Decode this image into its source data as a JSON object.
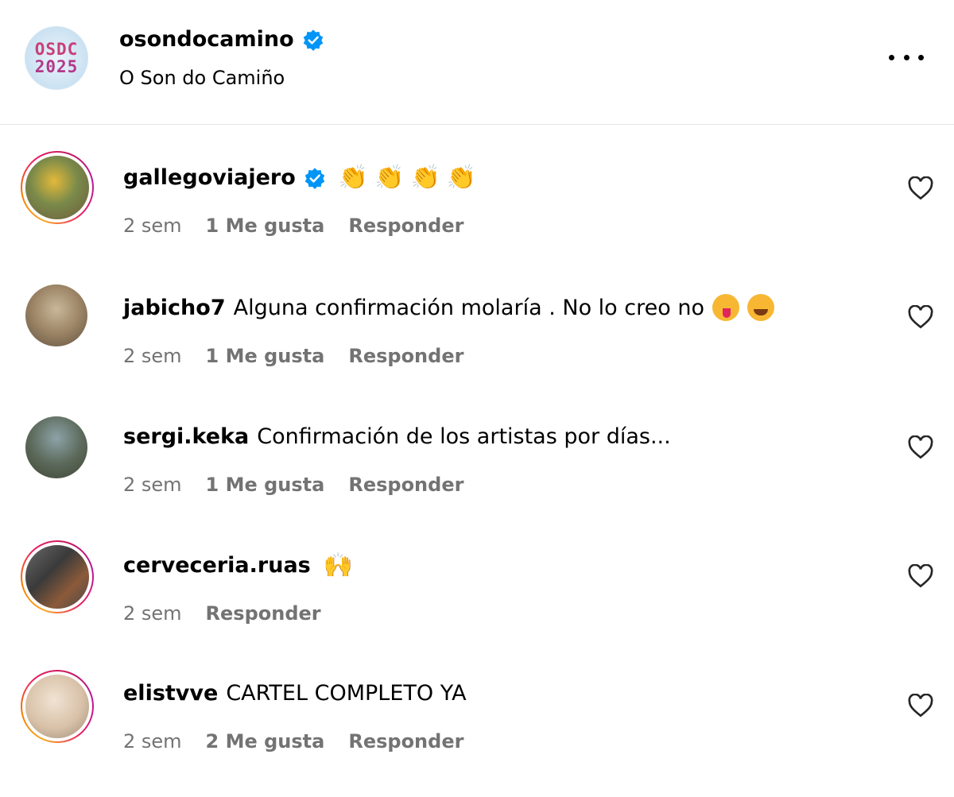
{
  "post": {
    "account": "osondocamino",
    "subtitle": "O Son do Camiño",
    "avatar_text_line1": "OSDC",
    "avatar_text_line2": "2025"
  },
  "colors": {
    "verified": "#0095f6",
    "meta_text": "#737373",
    "story_ring": "#e91e63"
  },
  "comments": [
    {
      "user": "gallegoviajero",
      "verified": true,
      "text": "",
      "emojis": "👏👏👏👏",
      "time": "2 sem",
      "likes": "1 Me gusta",
      "reply": "Responder"
    },
    {
      "user": "jabicho7",
      "verified": false,
      "text": "Alguna confirmación molaría . No lo creo no",
      "emojis": "😜🥳",
      "time": "2 sem",
      "likes": "1 Me gusta",
      "reply": "Responder"
    },
    {
      "user": "sergi.keka",
      "verified": false,
      "text": "Confirmación de los artistas por días...",
      "emojis": "",
      "time": "2 sem",
      "likes": "1 Me gusta",
      "reply": "Responder"
    },
    {
      "user": "cerveceria.ruas",
      "verified": false,
      "text": "",
      "emojis": "🙌",
      "time": "2 sem",
      "likes": "",
      "reply": "Responder"
    },
    {
      "user": "elistvve",
      "verified": false,
      "text": "CARTEL COMPLETO YA",
      "emojis": "",
      "time": "2 sem",
      "likes": "2 Me gusta",
      "reply": "Responder"
    }
  ],
  "icons": {
    "verified": "verified-badge-icon",
    "more": "more-options-icon",
    "like": "heart-icon"
  }
}
